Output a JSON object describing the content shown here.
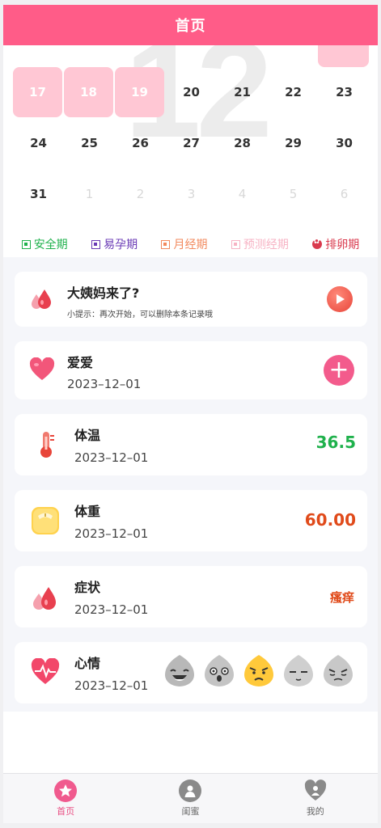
{
  "header": {
    "title": "首页"
  },
  "calendar": {
    "watermark": "12",
    "weeks": [
      [
        {
          "day": "17",
          "state": "period"
        },
        {
          "day": "18",
          "state": "period"
        },
        {
          "day": "19",
          "state": "period"
        },
        {
          "day": "20",
          "state": "normal"
        },
        {
          "day": "21",
          "state": "normal"
        },
        {
          "day": "22",
          "state": "normal"
        },
        {
          "day": "23",
          "state": "normal"
        }
      ],
      [
        {
          "day": "24",
          "state": "normal"
        },
        {
          "day": "25",
          "state": "normal"
        },
        {
          "day": "26",
          "state": "normal"
        },
        {
          "day": "27",
          "state": "normal"
        },
        {
          "day": "28",
          "state": "normal"
        },
        {
          "day": "29",
          "state": "normal"
        },
        {
          "day": "30",
          "state": "normal"
        }
      ],
      [
        {
          "day": "31",
          "state": "normal"
        },
        {
          "day": "1",
          "state": "next"
        },
        {
          "day": "2",
          "state": "next"
        },
        {
          "day": "3",
          "state": "next"
        },
        {
          "day": "4",
          "state": "next"
        },
        {
          "day": "5",
          "state": "next"
        },
        {
          "day": "6",
          "state": "next"
        }
      ]
    ]
  },
  "legend": [
    {
      "label": "安全期",
      "color": "#1fb14c"
    },
    {
      "label": "易孕期",
      "color": "#6a3ab5"
    },
    {
      "label": "月经期",
      "color": "#f28a5e"
    },
    {
      "label": "预测经期",
      "color": "#f7b3c4"
    },
    {
      "label": "排卵期",
      "color": "#d93a4e"
    }
  ],
  "cards": {
    "period": {
      "title": "大姨妈来了?",
      "tip": "小提示：再次开始，可以删除本条记录哦",
      "icon": "blood-drops-icon"
    },
    "love": {
      "title": "爱爱",
      "date": "2023–12–01",
      "icon": "heart-icon",
      "action": "+"
    },
    "temperature": {
      "title": "体温",
      "date": "2023–12–01",
      "value": "36.5",
      "value_color": "#1fb14c",
      "icon": "thermometer-icon"
    },
    "weight": {
      "title": "体重",
      "date": "2023–12–01",
      "value": "60.00",
      "value_color": "#e04a1a",
      "icon": "scale-icon"
    },
    "symptom": {
      "title": "症状",
      "date": "2023–12–01",
      "value": "瘙痒",
      "value_color": "#e04a1a",
      "icon": "blood-drops-icon"
    },
    "mood": {
      "title": "心情",
      "date": "2023–12–01",
      "icon": "heartbeat-icon",
      "faces": [
        "laughing-face-icon",
        "surprised-face-icon",
        "angry-face-icon",
        "calm-face-icon",
        "sad-face-icon"
      ]
    }
  },
  "tabbar": [
    {
      "label": "首页",
      "icon": "star-icon",
      "active": true
    },
    {
      "label": "闺蜜",
      "icon": "friend-icon",
      "active": false
    },
    {
      "label": "我的",
      "icon": "heart-person-icon",
      "active": false
    }
  ],
  "colors": {
    "brand": "#ff5c88",
    "period_day": "#ffc7d4",
    "accent_plus": "#f35b8c"
  }
}
